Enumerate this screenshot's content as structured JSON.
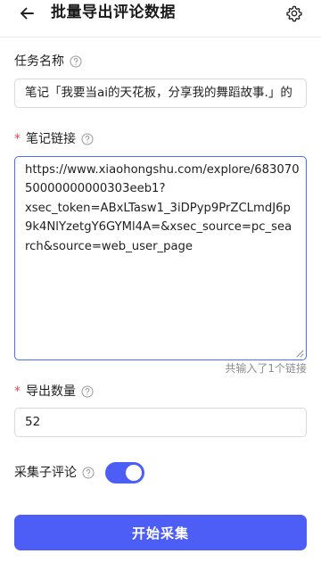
{
  "header": {
    "title": "批量导出评论数据"
  },
  "task_name": {
    "label": "任务名称",
    "value": "笔记「我要当ai的天花板，分享我的舞蹈故事.」的"
  },
  "note_link": {
    "required_mark": "*",
    "label": "笔记链接",
    "lines": [
      "https://www.xiaohongshu.com/explore/683070",
      "50000000000303eeb1?",
      "xsec_token=ABxLTasw1_3iDPyp9PrZCLmdJ6p",
      "9k4NlYzetgY6GYMl4A=&xsec_source=pc_sea",
      "rch&source=web_user_page"
    ],
    "hint": "共输入了1个链接"
  },
  "export_count": {
    "required_mark": "*",
    "label": "导出数量",
    "value": "52"
  },
  "sub_comments": {
    "label": "采集子评论",
    "enabled": true
  },
  "start_button": {
    "label": "开始采集"
  },
  "colors": {
    "accent": "#4d5ef7",
    "required": "#e5484d",
    "hint": "#8c8c8c"
  }
}
